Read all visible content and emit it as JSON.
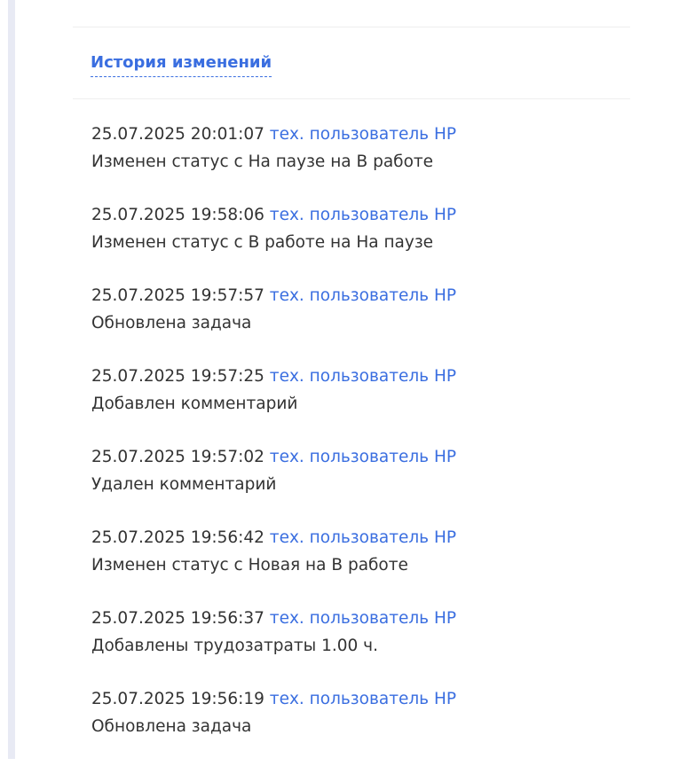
{
  "panel": {
    "title": "История изменений"
  },
  "history": [
    {
      "datetime": "25.07.2025 20:01:07",
      "user": "тех. пользователь НР",
      "action": "Изменен статус с На паузе на В работе"
    },
    {
      "datetime": "25.07.2025 19:58:06",
      "user": "тех. пользователь НР",
      "action": "Изменен статус с В работе на На паузе"
    },
    {
      "datetime": "25.07.2025 19:57:57",
      "user": "тех. пользователь НР",
      "action": "Обновлена задача"
    },
    {
      "datetime": "25.07.2025 19:57:25",
      "user": "тех. пользователь НР",
      "action": "Добавлен комментарий"
    },
    {
      "datetime": "25.07.2025 19:57:02",
      "user": "тех. пользователь НР",
      "action": "Удален комментарий"
    },
    {
      "datetime": "25.07.2025 19:56:42",
      "user": "тех. пользователь НР",
      "action": "Изменен статус с Новая на В работе"
    },
    {
      "datetime": "25.07.2025 19:56:37",
      "user": "тех. пользователь НР",
      "action": "Добавлены трудозатраты 1.00 ч."
    },
    {
      "datetime": "25.07.2025 19:56:19",
      "user": "тех. пользователь НР",
      "action": "Обновлена задача"
    }
  ],
  "colors": {
    "link": "#3a6ee0",
    "text": "#333333",
    "sidebar_strip": "#e8eaf4"
  }
}
